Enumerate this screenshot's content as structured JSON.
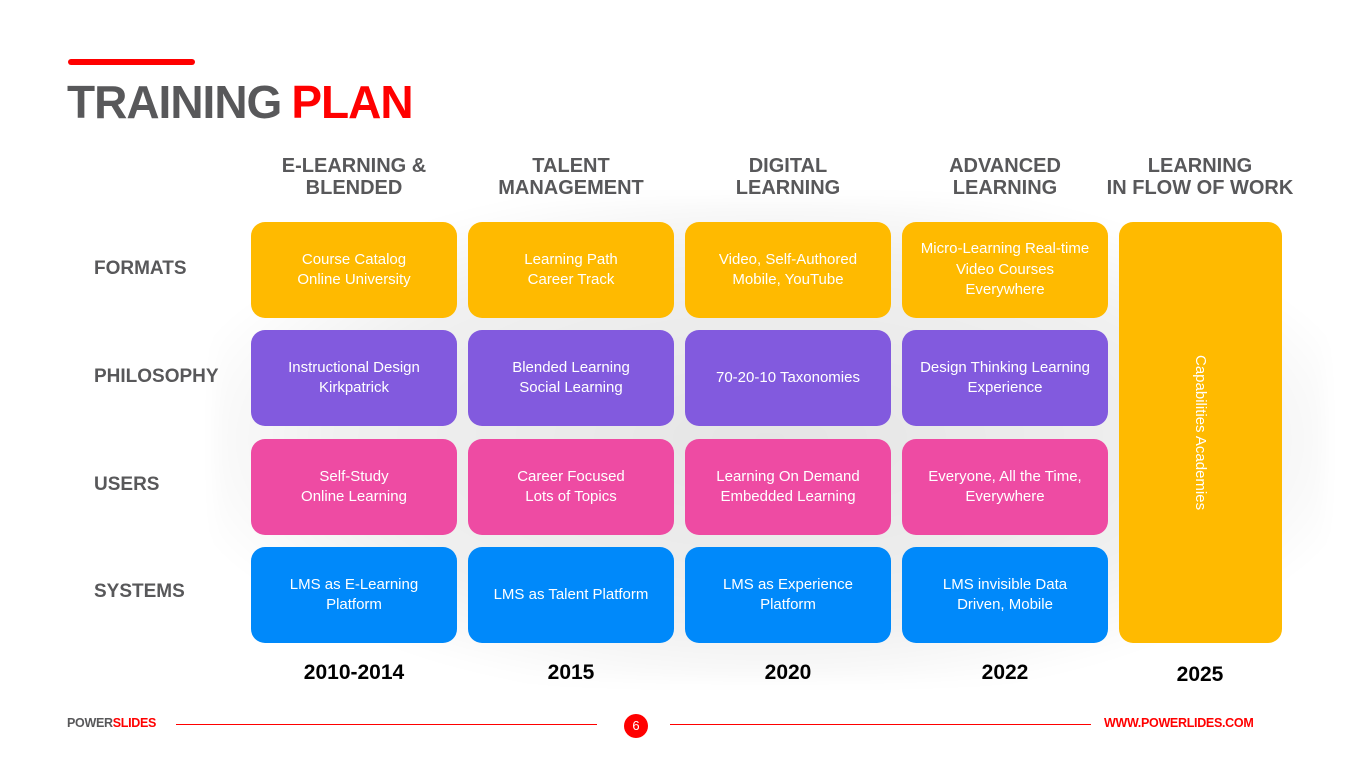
{
  "header": {
    "title_part1": "TRAINING",
    "title_part2": "PLAN"
  },
  "columns": [
    {
      "line1": "E-LEARNING &",
      "line2": "BLENDED",
      "year": "2010-2014"
    },
    {
      "line1": "TALENT",
      "line2": "MANAGEMENT",
      "year": "2015"
    },
    {
      "line1": "DIGITAL",
      "line2": "LEARNING",
      "year": "2020"
    },
    {
      "line1": "ADVANCED",
      "line2": "LEARNING",
      "year": "2022"
    },
    {
      "line1": "LEARNING",
      "line2": "IN FLOW OF WORK",
      "year": "2025"
    }
  ],
  "rows": [
    {
      "label": "FORMATS",
      "color": "#ffba00",
      "cells": [
        {
          "line1": "Course Catalog",
          "line2": "Online University",
          "line3": ""
        },
        {
          "line1": "Learning Path",
          "line2": "Career Track",
          "line3": ""
        },
        {
          "line1": "Video, Self-Authored",
          "line2": "Mobile, YouTube",
          "line3": ""
        },
        {
          "line1": "Micro-Learning Real-time",
          "line2": "Video Courses",
          "line3": "Everywhere"
        }
      ]
    },
    {
      "label": "PHILOSOPHY",
      "color": "#825ade",
      "cells": [
        {
          "line1": "Instructional Design",
          "line2": "Kirkpatrick",
          "line3": ""
        },
        {
          "line1": "Blended Learning",
          "line2": "Social Learning",
          "line3": ""
        },
        {
          "line1": "70-20-10 Taxonomies",
          "line2": "",
          "line3": ""
        },
        {
          "line1": "Design Thinking Learning",
          "line2": "Experience",
          "line3": ""
        }
      ]
    },
    {
      "label": "USERS",
      "color": "#ee4ba3",
      "cells": [
        {
          "line1": "Self-Study",
          "line2": "Online Learning",
          "line3": ""
        },
        {
          "line1": "Career Focused",
          "line2": "Lots of Topics",
          "line3": ""
        },
        {
          "line1": "Learning On Demand",
          "line2": "Embedded Learning",
          "line3": ""
        },
        {
          "line1": "Everyone, All the Time,",
          "line2": "Everywhere",
          "line3": ""
        }
      ]
    },
    {
      "label": "SYSTEMS",
      "color": "#0089fa",
      "cells": [
        {
          "line1": "LMS as E-Learning",
          "line2": "Platform",
          "line3": ""
        },
        {
          "line1": "LMS as Talent Platform",
          "line2": "",
          "line3": ""
        },
        {
          "line1": "LMS as Experience",
          "line2": "Platform",
          "line3": ""
        },
        {
          "line1": "LMS invisible Data",
          "line2": "Driven, Mobile",
          "line3": ""
        }
      ]
    }
  ],
  "spanning_card": {
    "text": "Capabilities Academies",
    "color": "#ffba00"
  },
  "footer": {
    "brand_part1": "POWER",
    "brand_part2": "SLIDES",
    "page_number": "6",
    "url": "WWW.POWERLIDES.COM"
  },
  "colors": {
    "accent": "#ff0000",
    "heading_gray": "#58585a"
  }
}
